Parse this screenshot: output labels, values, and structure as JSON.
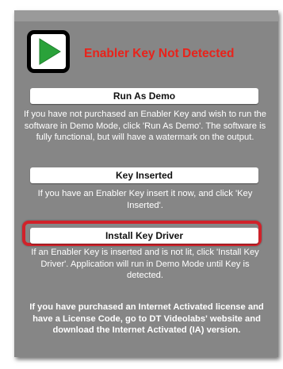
{
  "dialog": {
    "title": "Enabler Key Not Detected",
    "logo_icon": "play-icon",
    "colors": {
      "background": "#868686",
      "title": "#e8231b",
      "logo_green": "#2aa23a",
      "highlight": "#d1222a"
    }
  },
  "demo": {
    "button_label": "Run As Demo",
    "description": "If you have not purchased an Enabler Key and wish to run the software in Demo Mode, click 'Run As Demo'. The software is fully functional, but will have a watermark on the output."
  },
  "inserted": {
    "button_label": "Key Inserted",
    "description": "If you have an Enabler Key insert it now, and click 'Key Inserted'."
  },
  "driver": {
    "button_label": "Install Key Driver",
    "description": "If an Enabler Key is inserted and is not lit, click 'Install Key Driver'. Application will run in Demo Mode until Key is detected."
  },
  "license_info": "If you have purchased an Internet Activated license and have a License Code, go to DT Videolabs' website and download the Internet Activated (IA) version."
}
